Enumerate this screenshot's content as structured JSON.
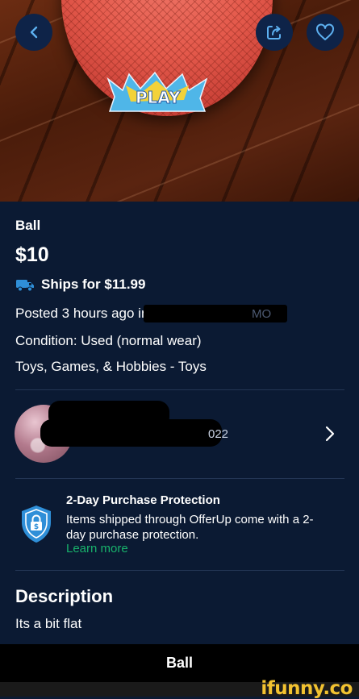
{
  "listing": {
    "title": "Ball",
    "price": "$10",
    "shipping": "Ships for $11.99",
    "posted": "Posted 3 hours ago in",
    "posted_location_tail": "MO",
    "condition": "Condition: Used (normal wear)",
    "category": "Toys, Games, & Hobbies - Toys",
    "ball_logo_text": "PLAY"
  },
  "seller": {
    "joined_fragment": "022"
  },
  "protection": {
    "title": "2-Day Purchase Protection",
    "body": "Items shipped through OfferUp come with a 2-day purchase protection.",
    "link": "Learn more"
  },
  "description": {
    "heading": "Description",
    "text": "Its a bit flat"
  },
  "bottom_bar": {
    "title": "Ball"
  },
  "watermark": "ifunny.co",
  "icons": {
    "back": "chevron-left-icon",
    "share": "share-icon",
    "favorite": "heart-icon",
    "shipping": "truck-icon",
    "protection": "shield-lock-icon",
    "seller_more": "chevron-right-icon"
  },
  "colors": {
    "background": "#0b1a33",
    "accent_link": "#18b26b",
    "shield": "#2f8fd8",
    "button_bg": "#0e2348"
  }
}
